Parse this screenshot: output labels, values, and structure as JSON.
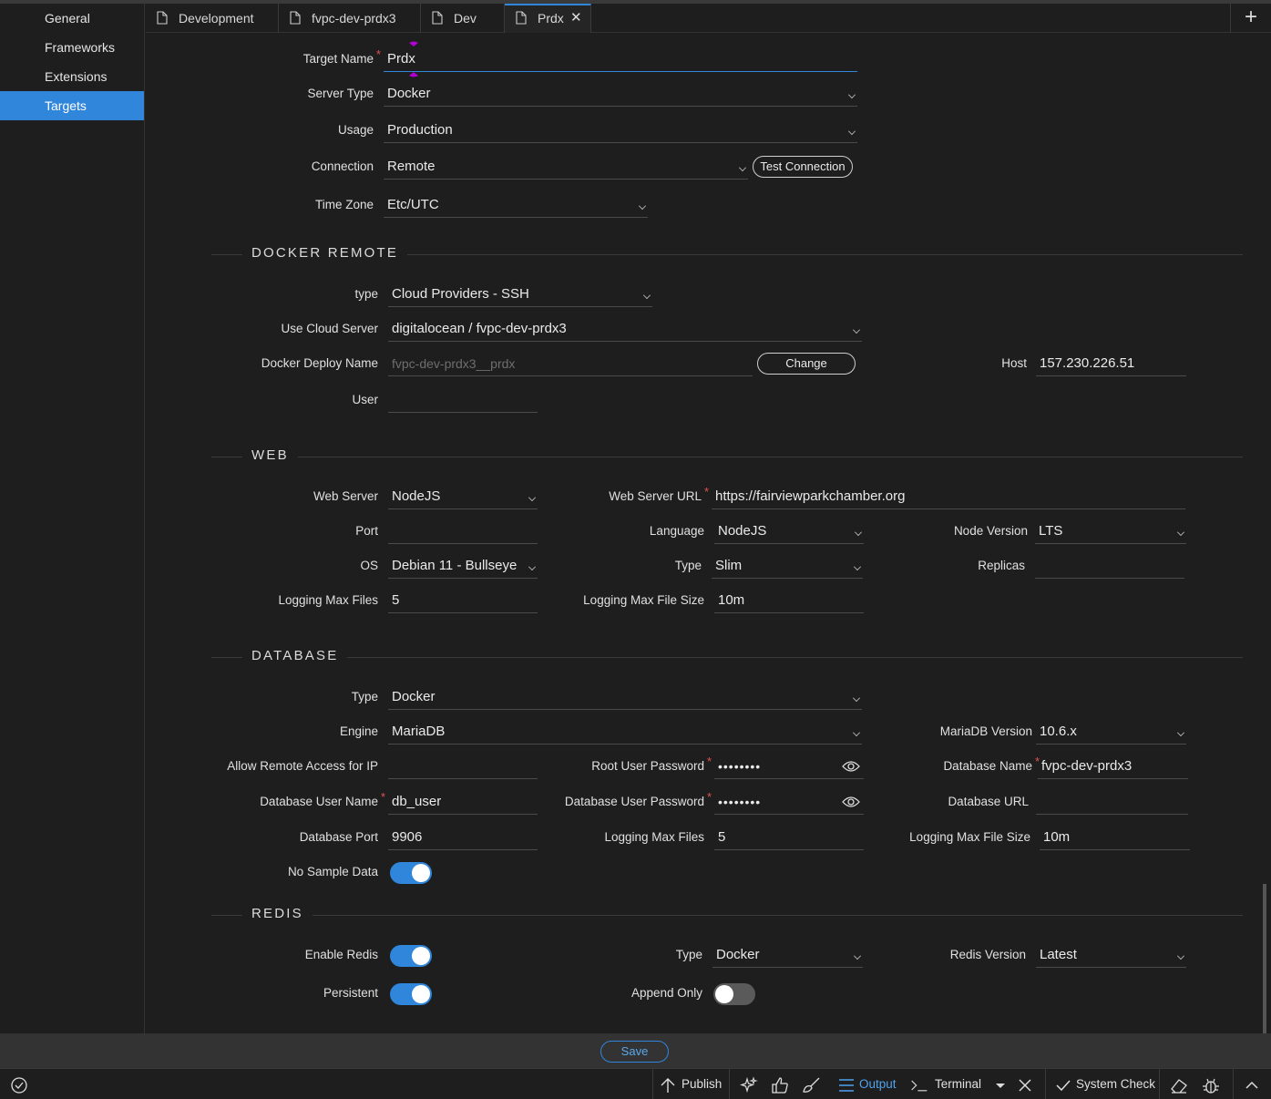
{
  "sidebar": {
    "items": [
      "General",
      "Frameworks",
      "Extensions",
      "Targets"
    ]
  },
  "tabs": [
    "Development",
    "fvpc-dev-prdx3",
    "Dev",
    "Prdx"
  ],
  "target": {
    "name_label": "Target Name",
    "name_value": "Prdx",
    "server_type_label": "Server Type",
    "server_type_value": "Docker",
    "usage_label": "Usage",
    "usage_value": "Production",
    "connection_label": "Connection",
    "connection_value": "Remote",
    "test_connection": "Test Connection",
    "timezone_label": "Time Zone",
    "timezone_value": "Etc/UTC"
  },
  "docker_remote": {
    "title": "DOCKER REMOTE",
    "type_label": "type",
    "type_value": "Cloud Providers - SSH",
    "cloud_label": "Use Cloud Server",
    "cloud_value": "digitalocean / fvpc-dev-prdx3",
    "deploy_label": "Docker Deploy Name",
    "deploy_value": "fvpc-dev-prdx3__prdx",
    "change": "Change",
    "host_label": "Host",
    "host_value": "157.230.226.51",
    "user_label": "User",
    "user_value": ""
  },
  "web": {
    "title": "WEB",
    "server_label": "Web Server",
    "server_value": "NodeJS",
    "url_label": "Web Server URL",
    "url_value": "https://fairviewparkchamber.org",
    "port_label": "Port",
    "port_value": "",
    "language_label": "Language",
    "language_value": "NodeJS",
    "node_label": "Node Version",
    "node_value": "LTS",
    "os_label": "OS",
    "os_value": "Debian 11 - Bullseye",
    "type_label": "Type",
    "type_value": "Slim",
    "replicas_label": "Replicas",
    "replicas_value": "",
    "logfiles_label": "Logging Max Files",
    "logfiles_value": "5",
    "logsize_label": "Logging Max File Size",
    "logsize_value": "10m"
  },
  "database": {
    "title": "DATABASE",
    "type_label": "Type",
    "type_value": "Docker",
    "engine_label": "Engine",
    "engine_value": "MariaDB",
    "version_label": "MariaDB Version",
    "version_value": "10.6.x",
    "remote_label": "Allow Remote Access for IP",
    "remote_value": "",
    "rootpw_label": "Root User Password",
    "rootpw_value": "••••••••",
    "dbname_label": "Database Name",
    "dbname_value": "fvpc-dev-prdx3",
    "dbuser_label": "Database User Name",
    "dbuser_value": "db_user",
    "dbuserpw_label": "Database User Password",
    "dbuserpw_value": "••••••••",
    "dburl_label": "Database URL",
    "dburl_value": "",
    "port_label": "Database Port",
    "port_value": "9906",
    "logfiles_label": "Logging Max Files",
    "logfiles_value": "5",
    "logsize_label": "Logging Max File Size",
    "logsize_value": "10m",
    "nosample_label": "No Sample Data",
    "nosample_on": true
  },
  "redis": {
    "title": "REDIS",
    "enable_label": "Enable Redis",
    "enable_on": true,
    "type_label": "Type",
    "type_value": "Docker",
    "version_label": "Redis Version",
    "version_value": "Latest",
    "persistent_label": "Persistent",
    "persistent_on": true,
    "append_label": "Append Only",
    "append_on": false
  },
  "actions": {
    "save": "Save"
  },
  "statusbar": {
    "publish": "Publish",
    "output": "Output",
    "terminal": "Terminal",
    "system_check": "System Check"
  },
  "colors": {
    "accent": "#2f86db",
    "required": "#e05252",
    "background": "#1e1e1e"
  }
}
